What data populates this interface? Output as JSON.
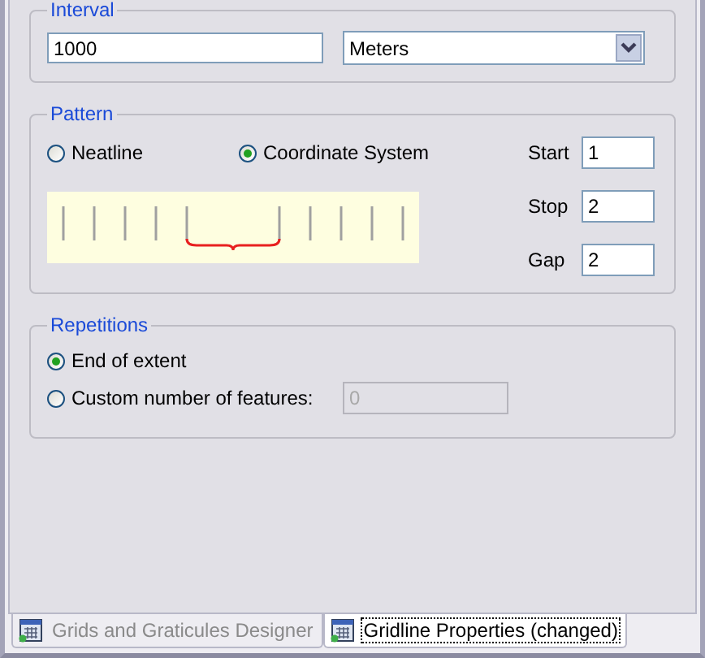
{
  "interval": {
    "title": "Interval",
    "value": "1000",
    "unit": "Meters"
  },
  "pattern": {
    "title": "Pattern",
    "options": [
      {
        "label": "Neatline",
        "selected": false
      },
      {
        "label": "Coordinate System",
        "selected": true
      }
    ],
    "fields": [
      {
        "label": "Start",
        "value": "1"
      },
      {
        "label": "Stop",
        "value": "2"
      },
      {
        "label": "Gap",
        "value": "2"
      }
    ]
  },
  "repetitions": {
    "title": "Repetitions",
    "options": [
      {
        "label": "End of extent",
        "selected": true
      },
      {
        "label": "Custom number of features:",
        "selected": false
      }
    ],
    "count": {
      "value": "0",
      "disabled": true
    }
  },
  "tabs": [
    {
      "label": "Grids and Graticules Designer",
      "selected": false
    },
    {
      "label": "Gridline Properties (changed)",
      "selected": true
    }
  ]
}
